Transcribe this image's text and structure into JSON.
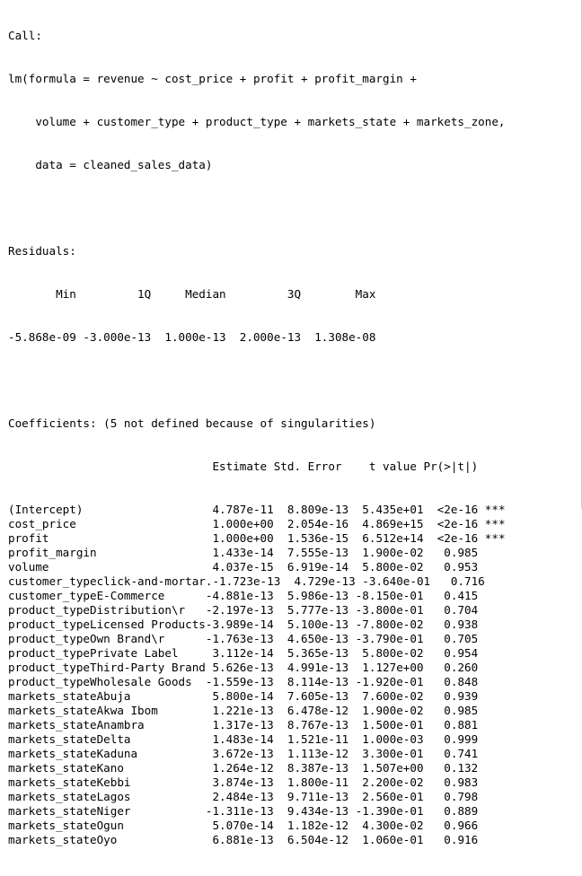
{
  "call": {
    "header": "Call:",
    "lines": [
      "lm(formula = revenue ~ cost_price + profit + profit_margin + ",
      "    volume + customer_type + product_type + markets_state + markets_zone, ",
      "    data = cleaned_sales_data)"
    ]
  },
  "residuals": {
    "header": "Residuals:",
    "labels_line": "       Min         1Q     Median         3Q        Max ",
    "values_line": "-5.868e-09 -3.000e-13  1.000e-13  2.000e-13  1.308e-08 "
  },
  "coefficients": {
    "header": "Coefficients: (5 not defined because of singularities)",
    "column_header": "                              Estimate Std. Error    t value Pr(>|t|)    ",
    "rows": [
      {
        "term": "(Intercept)                  ",
        "estimate": " 4.787e-11",
        "std_error": "  8.809e-13",
        "t_value": "  5.435e+01",
        "p_value": "  <2e-16",
        "signif": " ***"
      },
      {
        "term": "cost_price                   ",
        "estimate": " 1.000e+00",
        "std_error": "  2.054e-16",
        "t_value": "  4.869e+15",
        "p_value": "  <2e-16",
        "signif": " ***"
      },
      {
        "term": "profit                       ",
        "estimate": " 1.000e+00",
        "std_error": "  1.536e-15",
        "t_value": "  6.512e+14",
        "p_value": "  <2e-16",
        "signif": " ***"
      },
      {
        "term": "profit_margin                ",
        "estimate": " 1.433e-14",
        "std_error": "  7.555e-13",
        "t_value": "  1.900e-02",
        "p_value": "   0.985",
        "signif": "    "
      },
      {
        "term": "volume                       ",
        "estimate": " 4.037e-15",
        "std_error": "  6.919e-14",
        "t_value": "  5.800e-02",
        "p_value": "   0.953",
        "signif": "    "
      },
      {
        "term": "customer_typeclick-and-mortar.",
        "estimate": "-1.723e-13",
        "std_error": "  4.729e-13",
        "t_value": " -3.640e-01",
        "p_value": "   0.716",
        "signif": "    "
      },
      {
        "term": "customer_typeE-Commerce      ",
        "estimate": "-4.881e-13",
        "std_error": "  5.986e-13",
        "t_value": " -8.150e-01",
        "p_value": "   0.415",
        "signif": "    "
      },
      {
        "term": "product_typeDistribution\\r   ",
        "estimate": "-2.197e-13",
        "std_error": "  5.777e-13",
        "t_value": " -3.800e-01",
        "p_value": "   0.704",
        "signif": "    "
      },
      {
        "term": "product_typeLicensed Products",
        "estimate": "-3.989e-14",
        "std_error": "  5.100e-13",
        "t_value": " -7.800e-02",
        "p_value": "   0.938",
        "signif": "    "
      },
      {
        "term": "product_typeOwn Brand\\r      ",
        "estimate": "-1.763e-13",
        "std_error": "  4.650e-13",
        "t_value": " -3.790e-01",
        "p_value": "   0.705",
        "signif": "    "
      },
      {
        "term": "product_typePrivate Label    ",
        "estimate": " 3.112e-14",
        "std_error": "  5.365e-13",
        "t_value": "  5.800e-02",
        "p_value": "   0.954",
        "signif": "    "
      },
      {
        "term": "product_typeThird-Party Brand",
        "estimate": " 5.626e-13",
        "std_error": "  4.991e-13",
        "t_value": "  1.127e+00",
        "p_value": "   0.260",
        "signif": "    "
      },
      {
        "term": "product_typeWholesale Goods  ",
        "estimate": "-1.559e-13",
        "std_error": "  8.114e-13",
        "t_value": " -1.920e-01",
        "p_value": "   0.848",
        "signif": "    "
      },
      {
        "term": "markets_stateAbuja           ",
        "estimate": " 5.800e-14",
        "std_error": "  7.605e-13",
        "t_value": "  7.600e-02",
        "p_value": "   0.939",
        "signif": "    "
      },
      {
        "term": "markets_stateAkwa Ibom       ",
        "estimate": " 1.221e-13",
        "std_error": "  6.478e-12",
        "t_value": "  1.900e-02",
        "p_value": "   0.985",
        "signif": "    "
      },
      {
        "term": "markets_stateAnambra         ",
        "estimate": " 1.317e-13",
        "std_error": "  8.767e-13",
        "t_value": "  1.500e-01",
        "p_value": "   0.881",
        "signif": "    "
      },
      {
        "term": "markets_stateDelta           ",
        "estimate": " 1.483e-14",
        "std_error": "  1.521e-11",
        "t_value": "  1.000e-03",
        "p_value": "   0.999",
        "signif": "    "
      },
      {
        "term": "markets_stateKaduna          ",
        "estimate": " 3.672e-13",
        "std_error": "  1.113e-12",
        "t_value": "  3.300e-01",
        "p_value": "   0.741",
        "signif": "    "
      },
      {
        "term": "markets_stateKano            ",
        "estimate": " 1.264e-12",
        "std_error": "  8.387e-13",
        "t_value": "  1.507e+00",
        "p_value": "   0.132",
        "signif": "    "
      },
      {
        "term": "markets_stateKebbi           ",
        "estimate": " 3.874e-13",
        "std_error": "  1.800e-11",
        "t_value": "  2.200e-02",
        "p_value": "   0.983",
        "signif": "    "
      },
      {
        "term": "markets_stateLagos           ",
        "estimate": " 2.484e-13",
        "std_error": "  9.711e-13",
        "t_value": "  2.560e-01",
        "p_value": "   0.798",
        "signif": "    "
      },
      {
        "term": "markets_stateNiger           ",
        "estimate": "-1.311e-13",
        "std_error": "  9.434e-13",
        "t_value": " -1.390e-01",
        "p_value": "   0.889",
        "signif": "    "
      },
      {
        "term": "markets_stateOgun            ",
        "estimate": " 5.070e-14",
        "std_error": "  1.182e-12",
        "t_value": "  4.300e-02",
        "p_value": "   0.966",
        "signif": "    "
      },
      {
        "term": "markets_stateOyo             ",
        "estimate": " 6.881e-13",
        "std_error": "  6.504e-12",
        "t_value": "  1.060e-01",
        "p_value": "   0.916",
        "signif": "    "
      }
    ]
  }
}
